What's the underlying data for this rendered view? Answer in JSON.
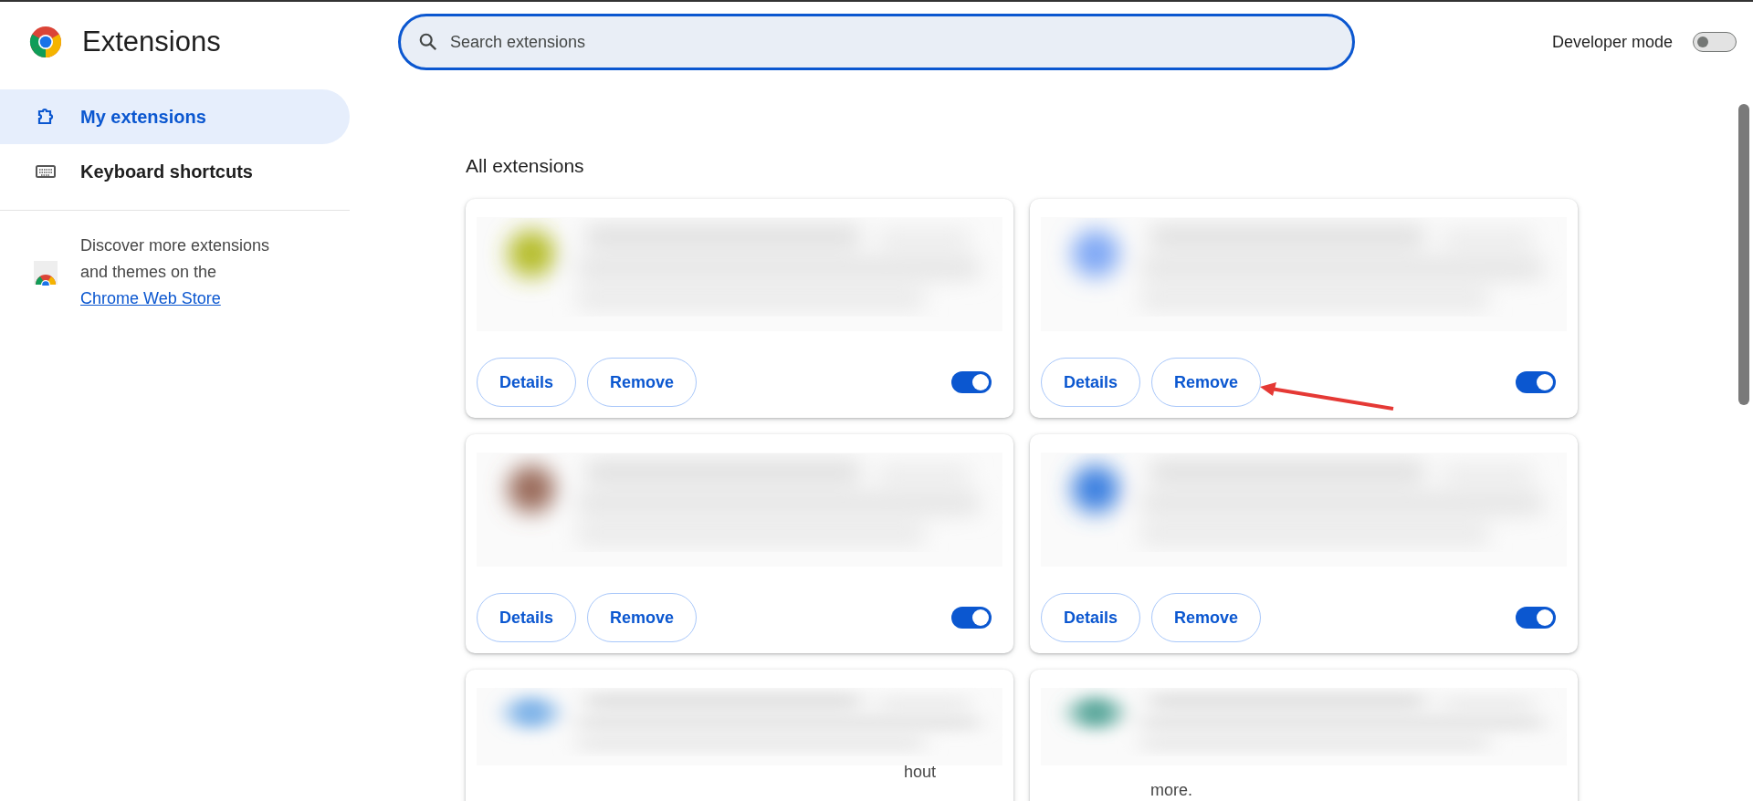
{
  "header": {
    "title": "Extensions",
    "search": {
      "placeholder": "Search extensions",
      "focused": true
    },
    "developer_mode": {
      "label": "Developer mode",
      "on": false
    }
  },
  "sidebar": {
    "items": [
      {
        "label": "My extensions",
        "selected": true,
        "kind": "puzzle"
      },
      {
        "label": "Keyboard shortcuts",
        "selected": false,
        "kind": "keyboard"
      }
    ],
    "store_promo": {
      "text": "Discover more extensions and themes on the",
      "link": "Chrome Web Store"
    }
  },
  "main": {
    "heading": "All extensions",
    "cards": [
      {
        "details": "Details",
        "remove": "Remove",
        "enabled": true
      },
      {
        "details": "Details",
        "remove": "Remove",
        "enabled": true,
        "annotated": true
      },
      {
        "details": "Details",
        "remove": "Remove",
        "enabled": true
      },
      {
        "details": "Details",
        "remove": "Remove",
        "enabled": true
      },
      {
        "fragment": "hout"
      },
      {
        "fragment": "more."
      }
    ]
  }
}
